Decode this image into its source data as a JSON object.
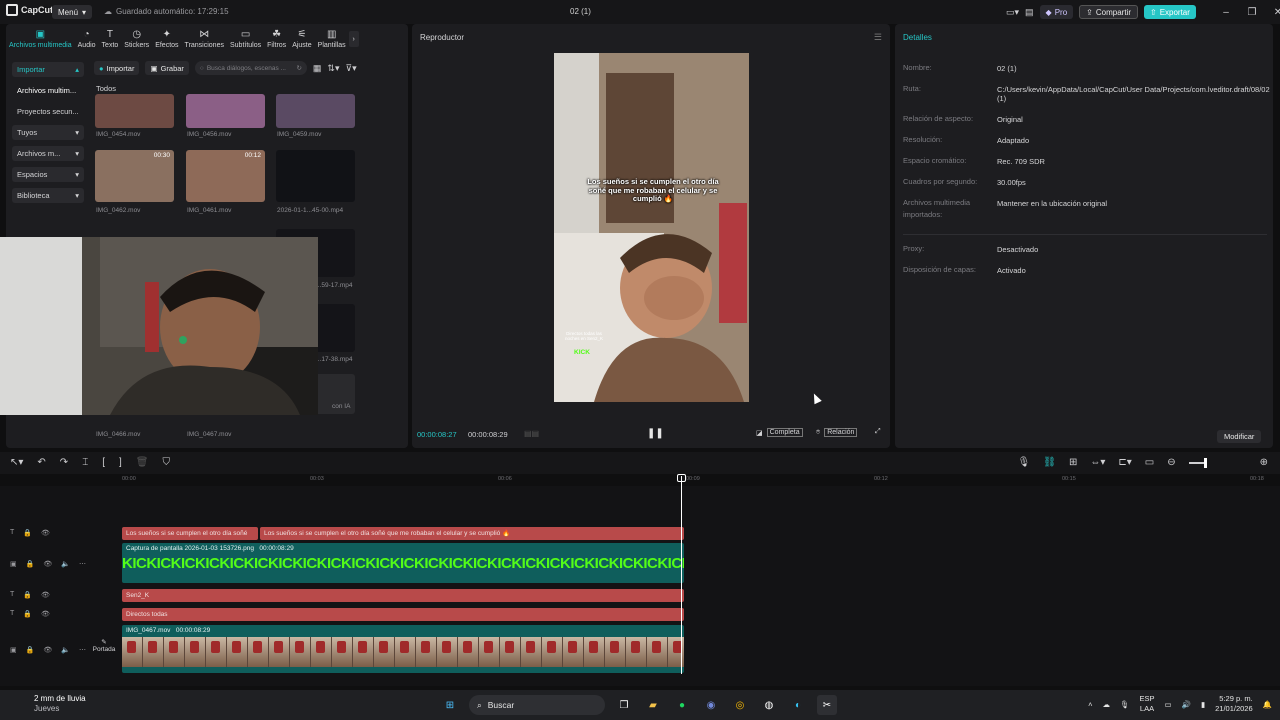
{
  "titlebar": {
    "app_name": "CapCut",
    "menu_label": "Menú",
    "autosave_label": "Guardado automático: 17:29:15",
    "project_title": "02 (1)",
    "pro_label": "Pro",
    "share_label": "Compartir",
    "export_label": "Exportar"
  },
  "media_tabs": [
    {
      "label": "Archivos multimedia",
      "icon": "media-icon"
    },
    {
      "label": "Audio",
      "icon": "audio-icon"
    },
    {
      "label": "Texto",
      "icon": "text-icon"
    },
    {
      "label": "Stickers",
      "icon": "sticker-icon"
    },
    {
      "label": "Efectos",
      "icon": "effects-icon"
    },
    {
      "label": "Transiciones",
      "icon": "transition-icon"
    },
    {
      "label": "Subtítulos",
      "icon": "subtitle-icon"
    },
    {
      "label": "Filtros",
      "icon": "filter-icon"
    },
    {
      "label": "Ajuste",
      "icon": "adjust-icon"
    },
    {
      "label": "Plantillas",
      "icon": "template-icon"
    }
  ],
  "sidenav": {
    "import": "Importar",
    "media_files": "Archivos multim...",
    "secondary_projects": "Proyectos secun...",
    "yours": "Tuyos",
    "media_files2": "Archivos m...",
    "spaces": "Espacios",
    "library": "Biblioteca"
  },
  "media_toolbar": {
    "import_label": "Importar",
    "record_label": "Grabar",
    "search_placeholder": "Busca diálogos, escenas ..."
  },
  "all_label": "Todos",
  "media_items": [
    {
      "name": "IMG_0454.mov",
      "duration": ""
    },
    {
      "name": "IMG_0456.mov",
      "duration": ""
    },
    {
      "name": "IMG_0459.mov",
      "duration": ""
    },
    {
      "name": "IMG_0462.mov",
      "duration": "00:30"
    },
    {
      "name": "IMG_0461.mov",
      "duration": "00:12"
    },
    {
      "name": "2026-01-1...45-00.mp4",
      "duration": ""
    },
    {
      "name": "...59-17.mp4",
      "duration": ""
    },
    {
      "name": "...17-38.mp4",
      "duration": ""
    },
    {
      "name": "IMG_0466.mov",
      "duration": ""
    },
    {
      "name": "IMG_0467.mov",
      "duration": ""
    },
    {
      "name": "con IA",
      "duration": ""
    }
  ],
  "player": {
    "title": "Reproductor",
    "caption": "Los sueños si se cumplen el otro día soñé que me robaban el celular y se cumplió 🔥",
    "small_overlay": "Directos todas las noches en Sen2_K",
    "kick_label": "KICK",
    "current_time": "00:00:08:27",
    "total_time": "00:00:08:29",
    "complete_label": "Completa",
    "ratio_label": "Relación"
  },
  "details": {
    "title": "Detalles",
    "rows": [
      {
        "key": "Nombre:",
        "value": "02 (1)"
      },
      {
        "key": "Ruta:",
        "value": "C:/Users/kevin/AppData/Local/CapCut/User Data/Projects/com.lveditor.draft/08/02 (1)"
      },
      {
        "key": "Relación de aspecto:",
        "value": "Original"
      },
      {
        "key": "Resolución:",
        "value": "Adaptado"
      },
      {
        "key": "Espacio cromático:",
        "value": "Rec. 709 SDR"
      },
      {
        "key": "Cuadros por segundo:",
        "value": "30.00fps"
      },
      {
        "key": "Archivos multimedia importados:",
        "value": "Mantener en la ubicación original"
      },
      {
        "key": "Proxy:",
        "value": "Desactivado"
      },
      {
        "key": "Disposición de capas:",
        "value": "Activado"
      }
    ],
    "modify_label": "Modificar"
  },
  "timeline": {
    "ruler": [
      "00:00",
      "00:03",
      "00:06",
      "00:09",
      "00:12",
      "00:15",
      "00:18"
    ],
    "text_clip_1a": "Los sueños si se cumplen el otro día soñé",
    "text_clip_1b": "Los sueños si se cumplen el otro día soñé que me robaban el celular y se cumplió 🔥",
    "image_clip_label": "Captura de pantalla 2026-01-03 153726.png",
    "image_clip_duration": "00:00:08:29",
    "kick_pattern": "KICKICKICKICKICKICKICKICKICKICKICKICKICKICKICKICKICKICKICKICKICKICKICKICKICK",
    "text_clip_2": "Sen2_K",
    "text_clip_3": "Directos todas",
    "video_clip_label": "IMG_0467.mov",
    "video_clip_duration": "00:00:08:29",
    "cover_label": "Portada"
  },
  "taskbar": {
    "weather_main": "2 mm de lluvia",
    "weather_sub": "Jueves",
    "search_label": "Buscar",
    "lang_main": "ESP",
    "lang_sub": "LAA",
    "time": "5:29 p. m.",
    "date": "21/01/2026"
  },
  "colors": {
    "accent": "#26c6c6",
    "text_clip": "#b84a4a",
    "media_clip": "#0f5e5c",
    "kick_green": "#53fc18"
  }
}
